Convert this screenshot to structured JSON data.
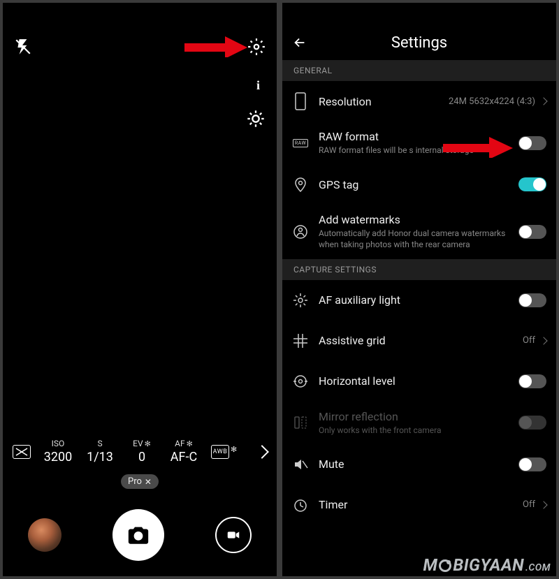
{
  "left": {
    "pro": {
      "iso": {
        "label": "ISO",
        "value": "3200"
      },
      "s": {
        "label": "S",
        "value": "1/13"
      },
      "ev": {
        "label": "EV",
        "value": "0"
      },
      "af": {
        "label": "AF",
        "value": "AF-C"
      },
      "awb": {
        "label": "AWB"
      }
    },
    "mode_chip": "Pro"
  },
  "right": {
    "title": "Settings",
    "sections": {
      "general": {
        "header": "GENERAL",
        "resolution": {
          "title": "Resolution",
          "value": "24M 5632x4224 (4:3)"
        },
        "raw": {
          "title": "RAW format",
          "sub": "RAW format files will be s              internal storage"
        },
        "gps": {
          "title": "GPS tag"
        },
        "watermark": {
          "title": "Add watermarks",
          "sub": "Automatically add Honor dual camera watermarks when taking photos with the rear camera"
        }
      },
      "capture": {
        "header": "CAPTURE SETTINGS",
        "af_light": {
          "title": "AF auxiliary light"
        },
        "grid": {
          "title": "Assistive grid",
          "value": "Off"
        },
        "level": {
          "title": "Horizontal level"
        },
        "mirror": {
          "title": "Mirror reflection",
          "sub": "Only works with the front camera"
        },
        "mute": {
          "title": "Mute"
        },
        "timer": {
          "title": "Timer",
          "value": "Off"
        }
      }
    }
  },
  "watermark": {
    "pre": "M",
    "mid": "BIGYAAN",
    "suf": ".COM"
  }
}
